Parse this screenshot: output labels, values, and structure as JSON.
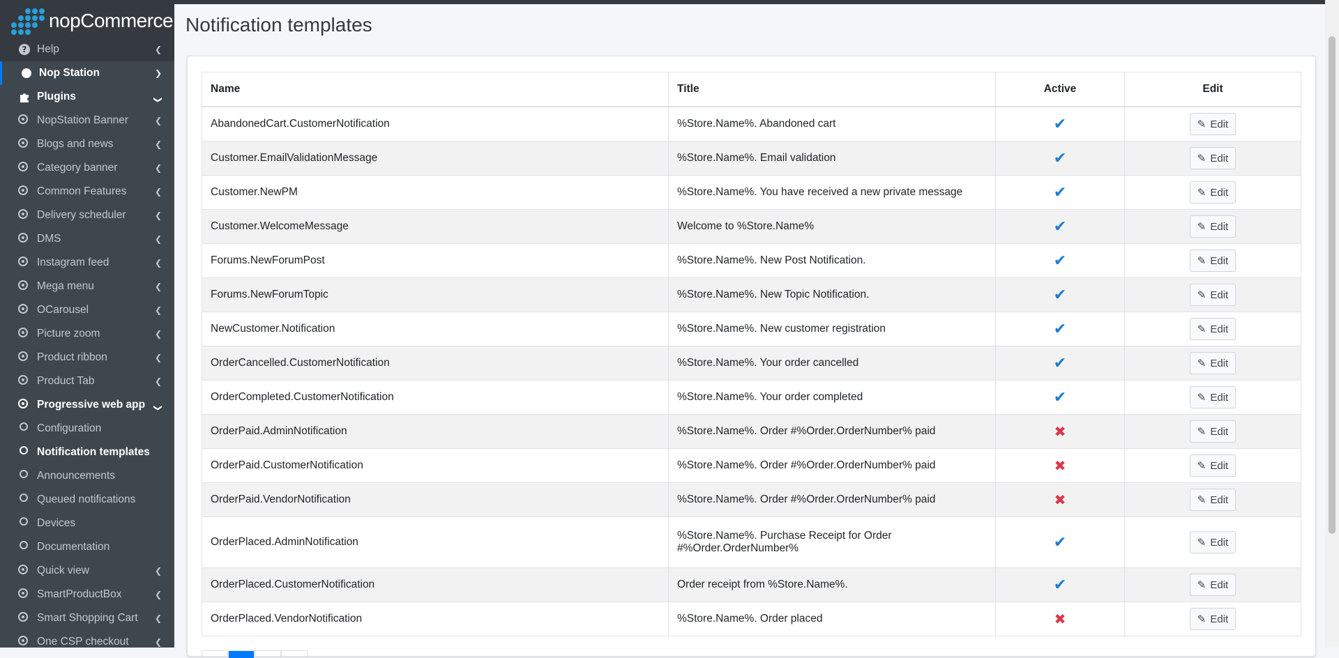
{
  "brand": {
    "name": "nopCommerce",
    "accent": "#27a0d8"
  },
  "sidebar": {
    "help": "Help",
    "nop_station": "Nop Station",
    "plugins": "Plugins",
    "plugin_items": [
      "NopStation Banner",
      "Blogs and news",
      "Category banner",
      "Common Features",
      "Delivery scheduler",
      "DMS",
      "Instagram feed",
      "Mega menu",
      "OCarousel",
      "Picture zoom",
      "Product ribbon",
      "Product Tab"
    ],
    "pwa": "Progressive web app",
    "pwa_sub": [
      "Configuration",
      "Notification templates",
      "Announcements",
      "Queued notifications",
      "Devices",
      "Documentation"
    ],
    "after_items": [
      "Quick view",
      "SmartProductBox",
      "Smart Shopping Cart",
      "One CSP checkout"
    ]
  },
  "page": {
    "title": "Notification templates"
  },
  "table": {
    "headers": {
      "name": "Name",
      "title": "Title",
      "active": "Active",
      "edit": "Edit"
    },
    "edit_label": "Edit",
    "rows": [
      {
        "name": "AbandonedCart.CustomerNotification",
        "title": "%Store.Name%. Abandoned cart",
        "active": true
      },
      {
        "name": "Customer.EmailValidationMessage",
        "title": "%Store.Name%. Email validation",
        "active": true
      },
      {
        "name": "Customer.NewPM",
        "title": "%Store.Name%. You have received a new private message",
        "active": true
      },
      {
        "name": "Customer.WelcomeMessage",
        "title": "Welcome to %Store.Name%",
        "active": true
      },
      {
        "name": "Forums.NewForumPost",
        "title": "%Store.Name%. New Post Notification.",
        "active": true
      },
      {
        "name": "Forums.NewForumTopic",
        "title": "%Store.Name%. New Topic Notification.",
        "active": true
      },
      {
        "name": "NewCustomer.Notification",
        "title": "%Store.Name%. New customer registration",
        "active": true
      },
      {
        "name": "OrderCancelled.CustomerNotification",
        "title": "%Store.Name%. Your order cancelled",
        "active": true
      },
      {
        "name": "OrderCompleted.CustomerNotification",
        "title": "%Store.Name%. Your order completed",
        "active": true
      },
      {
        "name": "OrderPaid.AdminNotification",
        "title": "%Store.Name%. Order #%Order.OrderNumber% paid",
        "active": false
      },
      {
        "name": "OrderPaid.CustomerNotification",
        "title": "%Store.Name%. Order #%Order.OrderNumber% paid",
        "active": false
      },
      {
        "name": "OrderPaid.VendorNotification",
        "title": "%Store.Name%. Order #%Order.OrderNumber% paid",
        "active": false
      },
      {
        "name": "OrderPlaced.AdminNotification",
        "title": "%Store.Name%. Purchase Receipt for Order #%Order.OrderNumber%",
        "active": true
      },
      {
        "name": "OrderPlaced.CustomerNotification",
        "title": "Order receipt from %Store.Name%.",
        "active": true
      },
      {
        "name": "OrderPlaced.VendorNotification",
        "title": "%Store.Name%. Order placed",
        "active": false
      }
    ]
  },
  "colors": {
    "sidebar_bg": "#343a40",
    "active_check": "#1c7cd6",
    "inactive_cross": "#dc3545"
  }
}
